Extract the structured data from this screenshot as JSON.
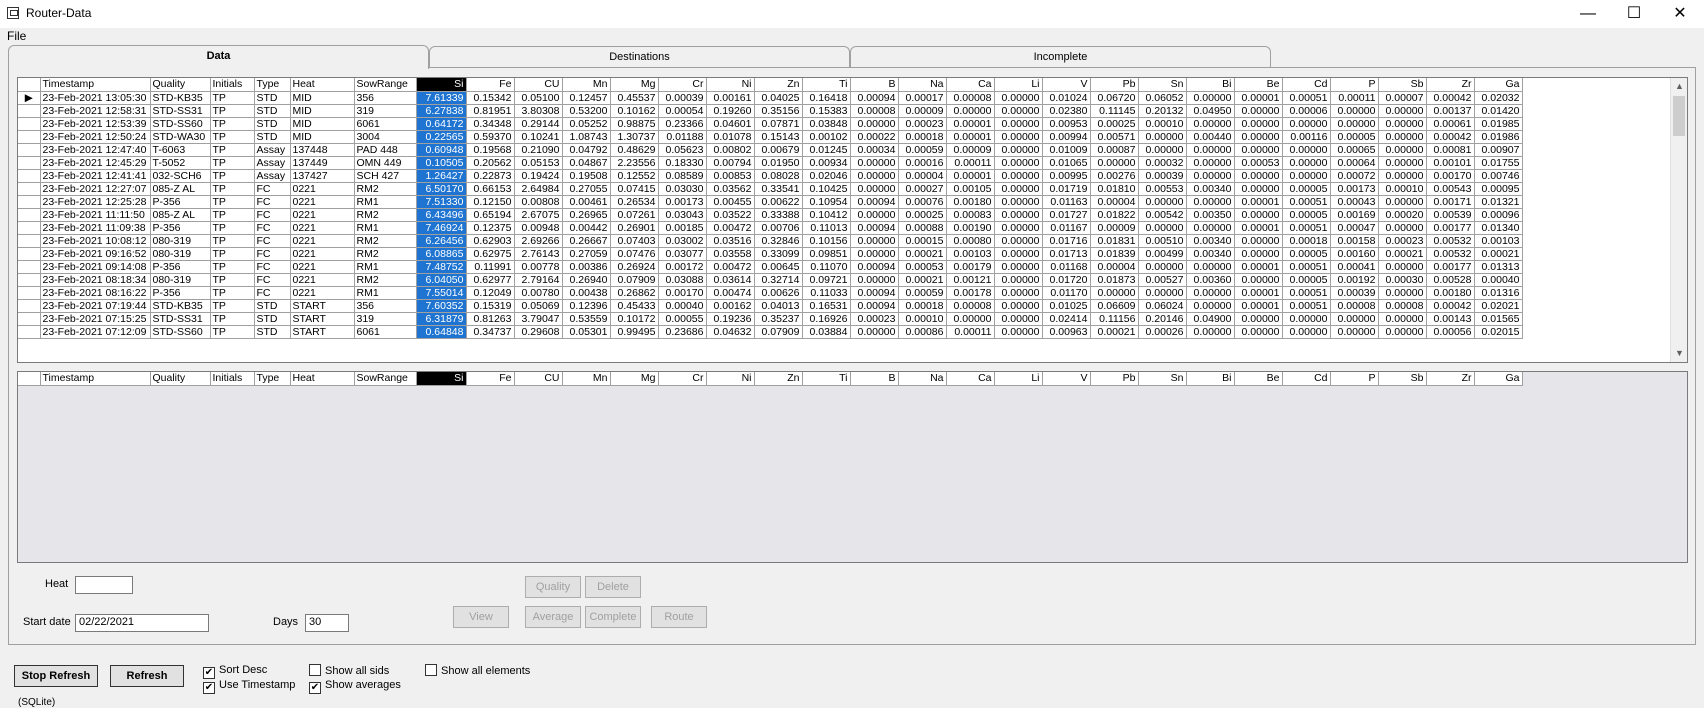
{
  "window": {
    "title": "Router-Data",
    "minimize": "—",
    "maximize": "☐",
    "close": "✕"
  },
  "menu": {
    "file": "File"
  },
  "tabs": [
    {
      "label": "Data"
    },
    {
      "label": "Destinations"
    },
    {
      "label": "Incomplete"
    }
  ],
  "columns": [
    "Timestamp",
    "Quality",
    "Initials",
    "Type",
    "Heat",
    "SowRange",
    "Si",
    "Fe",
    "CU",
    "Mn",
    "Mg",
    "Cr",
    "Ni",
    "Zn",
    "Ti",
    "B",
    "Na",
    "Ca",
    "Li",
    "V",
    "Pb",
    "Sn",
    "Bi",
    "Be",
    "Cd",
    "P",
    "Sb",
    "Zr",
    "Ga"
  ],
  "rows": [
    [
      "23-Feb-2021 13:05:30",
      "STD-KB35",
      "TP",
      "STD",
      "MID",
      "356",
      "7.61339",
      "0.15342",
      "0.05100",
      "0.12457",
      "0.45537",
      "0.00039",
      "0.00161",
      "0.04025",
      "0.16418",
      "0.00094",
      "0.00017",
      "0.00008",
      "0.00000",
      "0.01024",
      "0.06720",
      "0.06052",
      "0.00000",
      "0.00001",
      "0.00051",
      "0.00011",
      "0.00007",
      "0.00042",
      "0.02032"
    ],
    [
      "23-Feb-2021 12:58:31",
      "STD-SS31",
      "TP",
      "STD",
      "MID",
      "319",
      "6.27838",
      "0.81951",
      "3.80308",
      "0.53200",
      "0.10162",
      "0.00054",
      "0.19260",
      "0.35156",
      "0.15383",
      "0.00008",
      "0.00009",
      "0.00000",
      "0.00000",
      "0.02380",
      "0.11145",
      "0.20132",
      "0.04950",
      "0.00000",
      "0.00006",
      "0.00000",
      "0.00000",
      "0.00137",
      "0.01420"
    ],
    [
      "23-Feb-2021 12:53:39",
      "STD-SS60",
      "TP",
      "STD",
      "MID",
      "6061",
      "0.64172",
      "0.34348",
      "0.29144",
      "0.05252",
      "0.98875",
      "0.23366",
      "0.04601",
      "0.07871",
      "0.03848",
      "0.00000",
      "0.00023",
      "0.00001",
      "0.00000",
      "0.00953",
      "0.00025",
      "0.00010",
      "0.00000",
      "0.00000",
      "0.00000",
      "0.00000",
      "0.00000",
      "0.00061",
      "0.01985"
    ],
    [
      "23-Feb-2021 12:50:24",
      "STD-WA30",
      "TP",
      "STD",
      "MID",
      "3004",
      "0.22565",
      "0.59370",
      "0.10241",
      "1.08743",
      "1.30737",
      "0.01188",
      "0.01078",
      "0.15143",
      "0.00102",
      "0.00022",
      "0.00018",
      "0.00001",
      "0.00000",
      "0.00994",
      "0.00571",
      "0.00000",
      "0.00440",
      "0.00000",
      "0.00116",
      "0.00005",
      "0.00000",
      "0.00042",
      "0.01986"
    ],
    [
      "23-Feb-2021 12:47:40",
      "T-6063",
      "TP",
      "Assay",
      "137448",
      "PAD 448",
      "0.60948",
      "0.19568",
      "0.21090",
      "0.04792",
      "0.48629",
      "0.05623",
      "0.00802",
      "0.00679",
      "0.01245",
      "0.00034",
      "0.00059",
      "0.00009",
      "0.00000",
      "0.01009",
      "0.00087",
      "0.00000",
      "0.00000",
      "0.00000",
      "0.00000",
      "0.00065",
      "0.00000",
      "0.00081",
      "0.00907"
    ],
    [
      "23-Feb-2021 12:45:29",
      "T-5052",
      "TP",
      "Assay",
      "137449",
      "OMN 449",
      "0.10505",
      "0.20562",
      "0.05153",
      "0.04867",
      "2.23556",
      "0.18330",
      "0.00794",
      "0.01950",
      "0.00934",
      "0.00000",
      "0.00016",
      "0.00011",
      "0.00000",
      "0.01065",
      "0.00000",
      "0.00032",
      "0.00000",
      "0.00053",
      "0.00000",
      "0.00064",
      "0.00000",
      "0.00101",
      "0.01755"
    ],
    [
      "23-Feb-2021 12:41:41",
      "032-SCH6",
      "TP",
      "Assay",
      "137427",
      "SCH 427",
      "1.26427",
      "0.22873",
      "0.19424",
      "0.19508",
      "0.12552",
      "0.08589",
      "0.00853",
      "0.08028",
      "0.02046",
      "0.00000",
      "0.00004",
      "0.00001",
      "0.00000",
      "0.00995",
      "0.00276",
      "0.00039",
      "0.00000",
      "0.00000",
      "0.00000",
      "0.00072",
      "0.00000",
      "0.00170",
      "0.00746"
    ],
    [
      "23-Feb-2021 12:27:07",
      "085-Z AL",
      "TP",
      "FC",
      "0221",
      "RM2",
      "6.50170",
      "0.66153",
      "2.64984",
      "0.27055",
      "0.07415",
      "0.03030",
      "0.03562",
      "0.33541",
      "0.10425",
      "0.00000",
      "0.00027",
      "0.00105",
      "0.00000",
      "0.01719",
      "0.01810",
      "0.00553",
      "0.00340",
      "0.00000",
      "0.00005",
      "0.00173",
      "0.00010",
      "0.00543",
      "0.00095"
    ],
    [
      "23-Feb-2021 12:25:28",
      "P-356",
      "TP",
      "FC",
      "0221",
      "RM1",
      "7.51330",
      "0.12150",
      "0.00808",
      "0.00461",
      "0.26534",
      "0.00173",
      "0.00455",
      "0.00622",
      "0.10954",
      "0.00094",
      "0.00076",
      "0.00180",
      "0.00000",
      "0.01163",
      "0.00004",
      "0.00000",
      "0.00000",
      "0.00001",
      "0.00051",
      "0.00043",
      "0.00000",
      "0.00171",
      "0.01321"
    ],
    [
      "23-Feb-2021 11:11:50",
      "085-Z AL",
      "TP",
      "FC",
      "0221",
      "RM2",
      "6.43496",
      "0.65194",
      "2.67075",
      "0.26965",
      "0.07261",
      "0.03043",
      "0.03522",
      "0.33388",
      "0.10412",
      "0.00000",
      "0.00025",
      "0.00083",
      "0.00000",
      "0.01727",
      "0.01822",
      "0.00542",
      "0.00350",
      "0.00000",
      "0.00005",
      "0.00169",
      "0.00020",
      "0.00539",
      "0.00096"
    ],
    [
      "23-Feb-2021 11:09:38",
      "P-356",
      "TP",
      "FC",
      "0221",
      "RM1",
      "7.46924",
      "0.12375",
      "0.00948",
      "0.00442",
      "0.26901",
      "0.00185",
      "0.00472",
      "0.00706",
      "0.11013",
      "0.00094",
      "0.00088",
      "0.00190",
      "0.00000",
      "0.01167",
      "0.00009",
      "0.00000",
      "0.00000",
      "0.00001",
      "0.00051",
      "0.00047",
      "0.00000",
      "0.00177",
      "0.01340"
    ],
    [
      "23-Feb-2021 10:08:12",
      "080-319",
      "TP",
      "FC",
      "0221",
      "RM2",
      "6.26456",
      "0.62903",
      "2.69266",
      "0.26667",
      "0.07403",
      "0.03002",
      "0.03516",
      "0.32846",
      "0.10156",
      "0.00000",
      "0.00015",
      "0.00080",
      "0.00000",
      "0.01716",
      "0.01831",
      "0.00510",
      "0.00340",
      "0.00000",
      "0.00018",
      "0.00158",
      "0.00023",
      "0.00532",
      "0.00103"
    ],
    [
      "23-Feb-2021 09:16:52",
      "080-319",
      "TP",
      "FC",
      "0221",
      "RM2",
      "6.08865",
      "0.62975",
      "2.76143",
      "0.27059",
      "0.07476",
      "0.03077",
      "0.03558",
      "0.33099",
      "0.09851",
      "0.00000",
      "0.00021",
      "0.00103",
      "0.00000",
      "0.01713",
      "0.01839",
      "0.00499",
      "0.00340",
      "0.00000",
      "0.00005",
      "0.00160",
      "0.00021",
      "0.00532",
      "0.00021"
    ],
    [
      "23-Feb-2021 09:14:08",
      "P-356",
      "TP",
      "FC",
      "0221",
      "RM1",
      "7.48752",
      "0.11991",
      "0.00778",
      "0.00386",
      "0.26924",
      "0.00172",
      "0.00472",
      "0.00645",
      "0.11070",
      "0.00094",
      "0.00053",
      "0.00179",
      "0.00000",
      "0.01168",
      "0.00004",
      "0.00000",
      "0.00000",
      "0.00001",
      "0.00051",
      "0.00041",
      "0.00000",
      "0.00177",
      "0.01313"
    ],
    [
      "23-Feb-2021 08:18:34",
      "080-319",
      "TP",
      "FC",
      "0221",
      "RM2",
      "6.04050",
      "0.62977",
      "2.79164",
      "0.26940",
      "0.07909",
      "0.03088",
      "0.03614",
      "0.32714",
      "0.09721",
      "0.00000",
      "0.00021",
      "0.00121",
      "0.00000",
      "0.01720",
      "0.01873",
      "0.00527",
      "0.00360",
      "0.00000",
      "0.00005",
      "0.00192",
      "0.00030",
      "0.00528",
      "0.00040"
    ],
    [
      "23-Feb-2021 08:16:22",
      "P-356",
      "TP",
      "FC",
      "0221",
      "RM1",
      "7.55014",
      "0.12049",
      "0.00780",
      "0.00438",
      "0.26862",
      "0.00170",
      "0.00474",
      "0.00626",
      "0.11033",
      "0.00094",
      "0.00059",
      "0.00178",
      "0.00000",
      "0.01170",
      "0.00000",
      "0.00000",
      "0.00000",
      "0.00001",
      "0.00051",
      "0.00039",
      "0.00000",
      "0.00180",
      "0.01316"
    ],
    [
      "23-Feb-2021 07:19:44",
      "STD-KB35",
      "TP",
      "STD",
      "START",
      "356",
      "7.60352",
      "0.15319",
      "0.05069",
      "0.12396",
      "0.45433",
      "0.00040",
      "0.00162",
      "0.04013",
      "0.16531",
      "0.00094",
      "0.00018",
      "0.00008",
      "0.00000",
      "0.01025",
      "0.06609",
      "0.06024",
      "0.00000",
      "0.00001",
      "0.00051",
      "0.00008",
      "0.00008",
      "0.00042",
      "0.02021"
    ],
    [
      "23-Feb-2021 07:15:25",
      "STD-SS31",
      "TP",
      "STD",
      "START",
      "319",
      "6.31879",
      "0.81263",
      "3.79047",
      "0.53559",
      "0.10172",
      "0.00055",
      "0.19236",
      "0.35237",
      "0.16926",
      "0.00023",
      "0.00010",
      "0.00000",
      "0.00000",
      "0.02414",
      "0.11156",
      "0.20146",
      "0.04900",
      "0.00000",
      "0.00000",
      "0.00000",
      "0.00000",
      "0.00143",
      "0.01565"
    ],
    [
      "23-Feb-2021 07:12:09",
      "STD-SS60",
      "TP",
      "STD",
      "START",
      "6061",
      "0.64848",
      "0.34737",
      "0.29608",
      "0.05301",
      "0.99495",
      "0.23686",
      "0.04632",
      "0.07909",
      "0.03884",
      "0.00000",
      "0.00086",
      "0.00011",
      "0.00000",
      "0.00963",
      "0.00021",
      "0.00026",
      "0.00000",
      "0.00000",
      "0.00000",
      "0.00000",
      "0.00000",
      "0.00056",
      "0.02015"
    ]
  ],
  "form": {
    "heat_label": "Heat",
    "heat_value": "",
    "start_label": "Start date",
    "start_value": "02/22/2021",
    "days_label": "Days",
    "days_value": "30",
    "btn_quality": "Quality",
    "btn_delete": "Delete",
    "btn_view": "View",
    "btn_average": "Average",
    "btn_complete": "Complete",
    "btn_route": "Route"
  },
  "bottom": {
    "stop_refresh": "Stop Refresh",
    "refresh": "Refresh",
    "sort_desc": "Sort Desc",
    "use_timestamp": "Use Timestamp",
    "show_all_sids": "Show all sids",
    "show_averages": "Show averages",
    "show_all_elements": "Show all elements",
    "check_mark": "✔"
  },
  "status": "(SQLite)",
  "colors": {
    "selected_column": "#1e74d0"
  }
}
